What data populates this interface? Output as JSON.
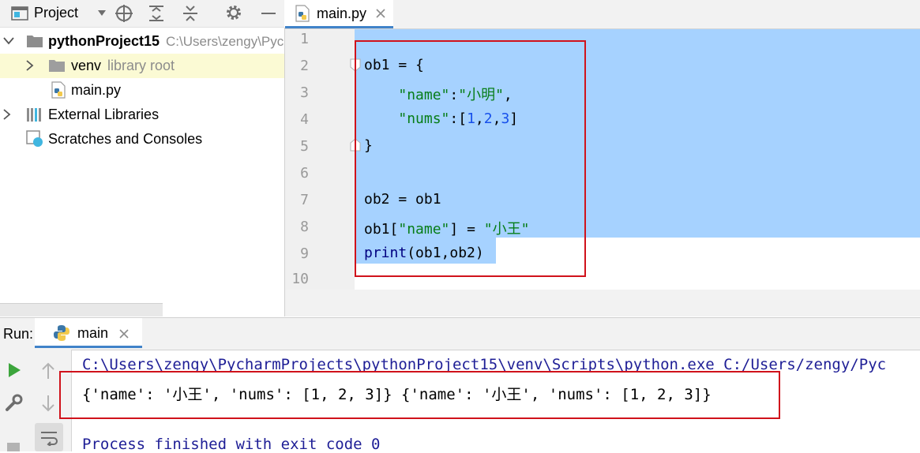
{
  "project_panel": {
    "title": "Project",
    "tree": [
      {
        "label": "pythonProject15",
        "path": "C:\\Users\\zengy\\Pyc"
      },
      {
        "label": "venv",
        "hint": "library root"
      },
      {
        "label": "main.py"
      },
      {
        "label": "External Libraries"
      },
      {
        "label": "Scratches and Consoles"
      }
    ]
  },
  "editor": {
    "tab_label": "main.py",
    "line_numbers": [
      "1",
      "2",
      "3",
      "4",
      "5",
      "6",
      "7",
      "8",
      "9",
      "10"
    ]
  },
  "run": {
    "label": "Run:",
    "tab_label": "main",
    "console": {
      "command": "C:\\Users\\zengy\\PycharmProjects\\pythonProject15\\venv\\Scripts\\python.exe C:/Users/zengy/Pyc",
      "output": "{'name': '小王', 'nums': [1, 2, 3]} {'name': '小王', 'nums': [1, 2, 3]}",
      "exit_message": "Process finished with exit code 0"
    }
  },
  "colors": {
    "selection": "#a6d2ff",
    "annotation_box": "#d0121b",
    "accent": "#4083c9"
  }
}
